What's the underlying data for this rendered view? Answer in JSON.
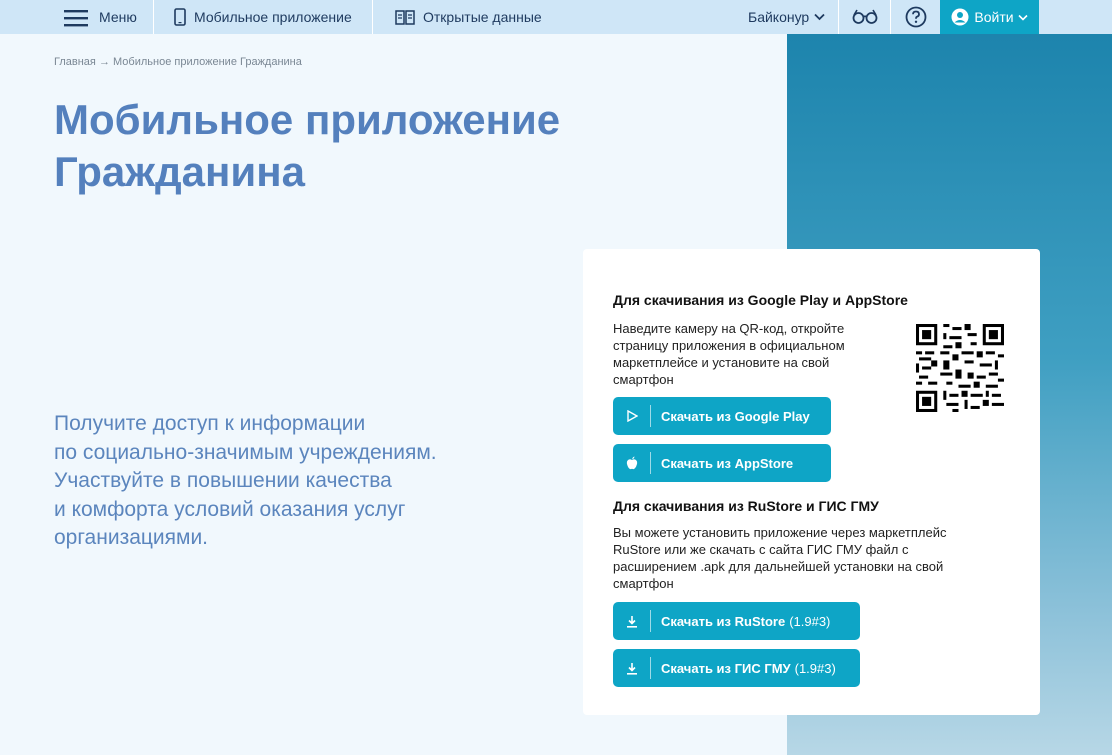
{
  "nav": {
    "menu_label": "Меню",
    "mobile_app_label": "Мобильное приложение",
    "open_data_label": "Открытые данные",
    "region_label": "Байконур",
    "login_label": "Войти"
  },
  "breadcrumb": {
    "home": "Главная",
    "separator": "→",
    "current": "Мобильное приложение Гражданина"
  },
  "page": {
    "title_line1": "Мобильное приложение",
    "title_line2": "Гражданина",
    "lead_lines": [
      "Получите доступ к информации",
      "по социально-значимым учреждениям.",
      "Участвуйте в повышении качества",
      "и комфорта условий оказания услуг",
      "организациями."
    ]
  },
  "card": {
    "section1": {
      "title": "Для скачивания из Google Play и AppStore",
      "text": "Наведите камеру на QR-код, откройте страницу приложения в официальном маркетплейсе и установите на свой смартфон",
      "google_play_label": "Скачать из Google Play",
      "appstore_label": "Скачать из AppStore"
    },
    "section2": {
      "title": "Для скачивания из RuStore и ГИС ГМУ",
      "text": "Вы можете установить приложение через маркетплейс RuStore или же скачать с сайта ГИС ГМУ файл с расширением .apk для дальнейшей установки на свой смартфон",
      "rustore_label": "Скачать из RuStore",
      "rustore_version": "(1.9#3)",
      "gis_label": "Скачать из ГИС ГМУ",
      "gis_version": "(1.9#3)"
    }
  },
  "colors": {
    "accent": "#0ea5c6",
    "title": "#5480bd",
    "topbar": "#cfe6f7"
  }
}
